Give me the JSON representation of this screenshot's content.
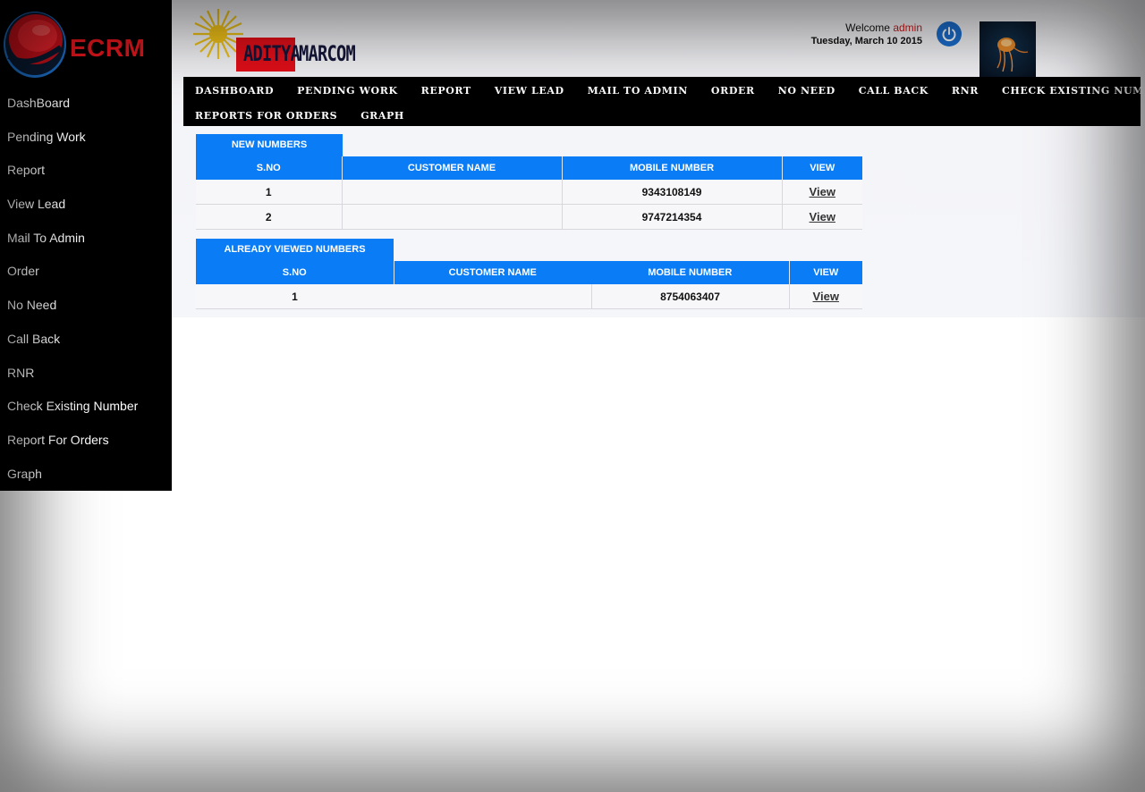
{
  "sidebar": {
    "logo_text": "ECRM",
    "items": [
      {
        "label": "DashBoard"
      },
      {
        "label": "Pending Work"
      },
      {
        "label": "Report"
      },
      {
        "label": "View Lead"
      },
      {
        "label": "Mail To Admin"
      },
      {
        "label": "Order"
      },
      {
        "label": "No Need"
      },
      {
        "label": "Call Back"
      },
      {
        "label": "RNR"
      },
      {
        "label": "Check Existing Number"
      },
      {
        "label": "Report For Orders"
      },
      {
        "label": "Graph"
      }
    ]
  },
  "header": {
    "brand_part1": "ADITYA",
    "brand_part2": "MARCOM",
    "welcome_label": "Welcome",
    "username": "admin",
    "date": "Tuesday, March 10 2015",
    "power_icon": "power-icon",
    "avatar_icon": "jellyfish-avatar"
  },
  "nav": {
    "row1": [
      "DASHBOARD",
      "PENDING WORK",
      "REPORT",
      "VIEW LEAD",
      "MAIL TO ADMIN",
      "ORDER",
      "NO NEED",
      "CALL BACK",
      "RNR",
      "CHECK EXISTING NUMBER"
    ],
    "row2": [
      "REPORTS FOR ORDERS",
      "GRAPH"
    ]
  },
  "new_numbers": {
    "title": "NEW NUMBERS",
    "columns": [
      "S.NO",
      "CUSTOMER NAME",
      "MOBILE NUMBER",
      "VIEW"
    ],
    "rows": [
      {
        "sno": "1",
        "name": "",
        "mobile": "9343108149",
        "view": "View"
      },
      {
        "sno": "2",
        "name": "",
        "mobile": "9747214354",
        "view": "View"
      }
    ]
  },
  "viewed_numbers": {
    "title": "ALREADY VIEWED NUMBERS",
    "columns": [
      "S.NO",
      "CUSTOMER NAME",
      "MOBILE NUMBER",
      "VIEW"
    ],
    "rows": [
      {
        "sno": "1",
        "name": "",
        "mobile": "8754063407",
        "view": "View"
      }
    ]
  },
  "colors": {
    "accent_blue": "#0a7cf5",
    "logo_red": "#e0161d",
    "username_red": "#c61b1b",
    "power_blue": "#1c6fd0"
  }
}
